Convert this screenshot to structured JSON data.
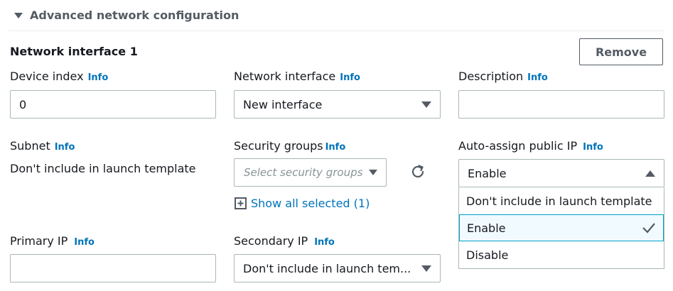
{
  "section": {
    "title": "Advanced network configuration"
  },
  "interface": {
    "title": "Network interface 1",
    "remove_label": "Remove"
  },
  "info_label": "Info",
  "device_index": {
    "label": "Device index",
    "value": "0"
  },
  "network_interface": {
    "label": "Network interface",
    "value": "New interface"
  },
  "description": {
    "label": "Description",
    "value": ""
  },
  "subnet": {
    "label": "Subnet",
    "value": "Don't include in launch template"
  },
  "security_groups": {
    "label": "Security groups",
    "placeholder": "Select security groups",
    "show_all": "Show all selected (1)"
  },
  "auto_assign": {
    "label": "Auto-assign public IP",
    "value": "Enable",
    "options": [
      "Don't include in launch template",
      "Enable",
      "Disable"
    ],
    "selected_index": 1
  },
  "primary_ip": {
    "label": "Primary IP",
    "value": ""
  },
  "secondary_ip": {
    "label": "Secondary IP",
    "value": "Don't include in launch tem..."
  },
  "colors": {
    "link": "#0073bb",
    "selected_border": "#00a1c9",
    "selected_bg": "#f1faff"
  }
}
